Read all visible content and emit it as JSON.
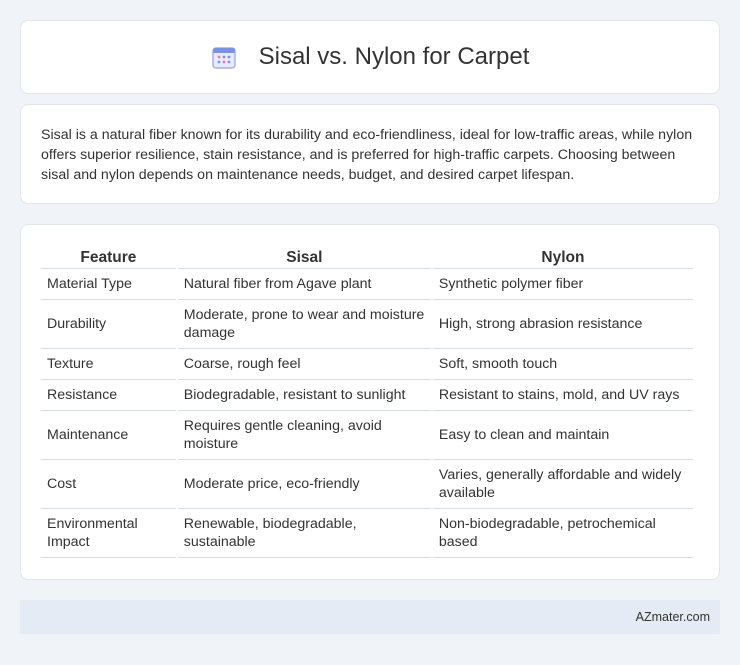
{
  "header": {
    "title": "Sisal vs. Nylon for Carpet",
    "icon": "calendar-icon"
  },
  "intro": {
    "text": "Sisal is a natural fiber known for its durability and eco-friendliness, ideal for low-traffic areas, while nylon offers superior resilience, stain resistance, and is preferred for high-traffic carpets. Choosing between sisal and nylon depends on maintenance needs, budget, and desired carpet lifespan."
  },
  "table": {
    "headers": [
      "Feature",
      "Sisal",
      "Nylon"
    ],
    "rows": [
      [
        "Material Type",
        "Natural fiber from Agave plant",
        "Synthetic polymer fiber"
      ],
      [
        "Durability",
        "Moderate, prone to wear and moisture damage",
        "High, strong abrasion resistance"
      ],
      [
        "Texture",
        "Coarse, rough feel",
        "Soft, smooth touch"
      ],
      [
        "Resistance",
        "Biodegradable, resistant to sunlight",
        "Resistant to stains, mold, and UV rays"
      ],
      [
        "Maintenance",
        "Requires gentle cleaning, avoid moisture",
        "Easy to clean and maintain"
      ],
      [
        "Cost",
        "Moderate price, eco-friendly",
        "Varies, generally affordable and widely available"
      ],
      [
        "Environmental Impact",
        "Renewable, biodegradable, sustainable",
        "Non-biodegradable, petrochemical based"
      ]
    ]
  },
  "footer": {
    "text": "AZmater.com"
  },
  "colors": {
    "background": "#f0f3f8",
    "card": "#ffffff",
    "footer_bg": "#e5ebf5",
    "icon_accent": "#7b8fe0"
  }
}
